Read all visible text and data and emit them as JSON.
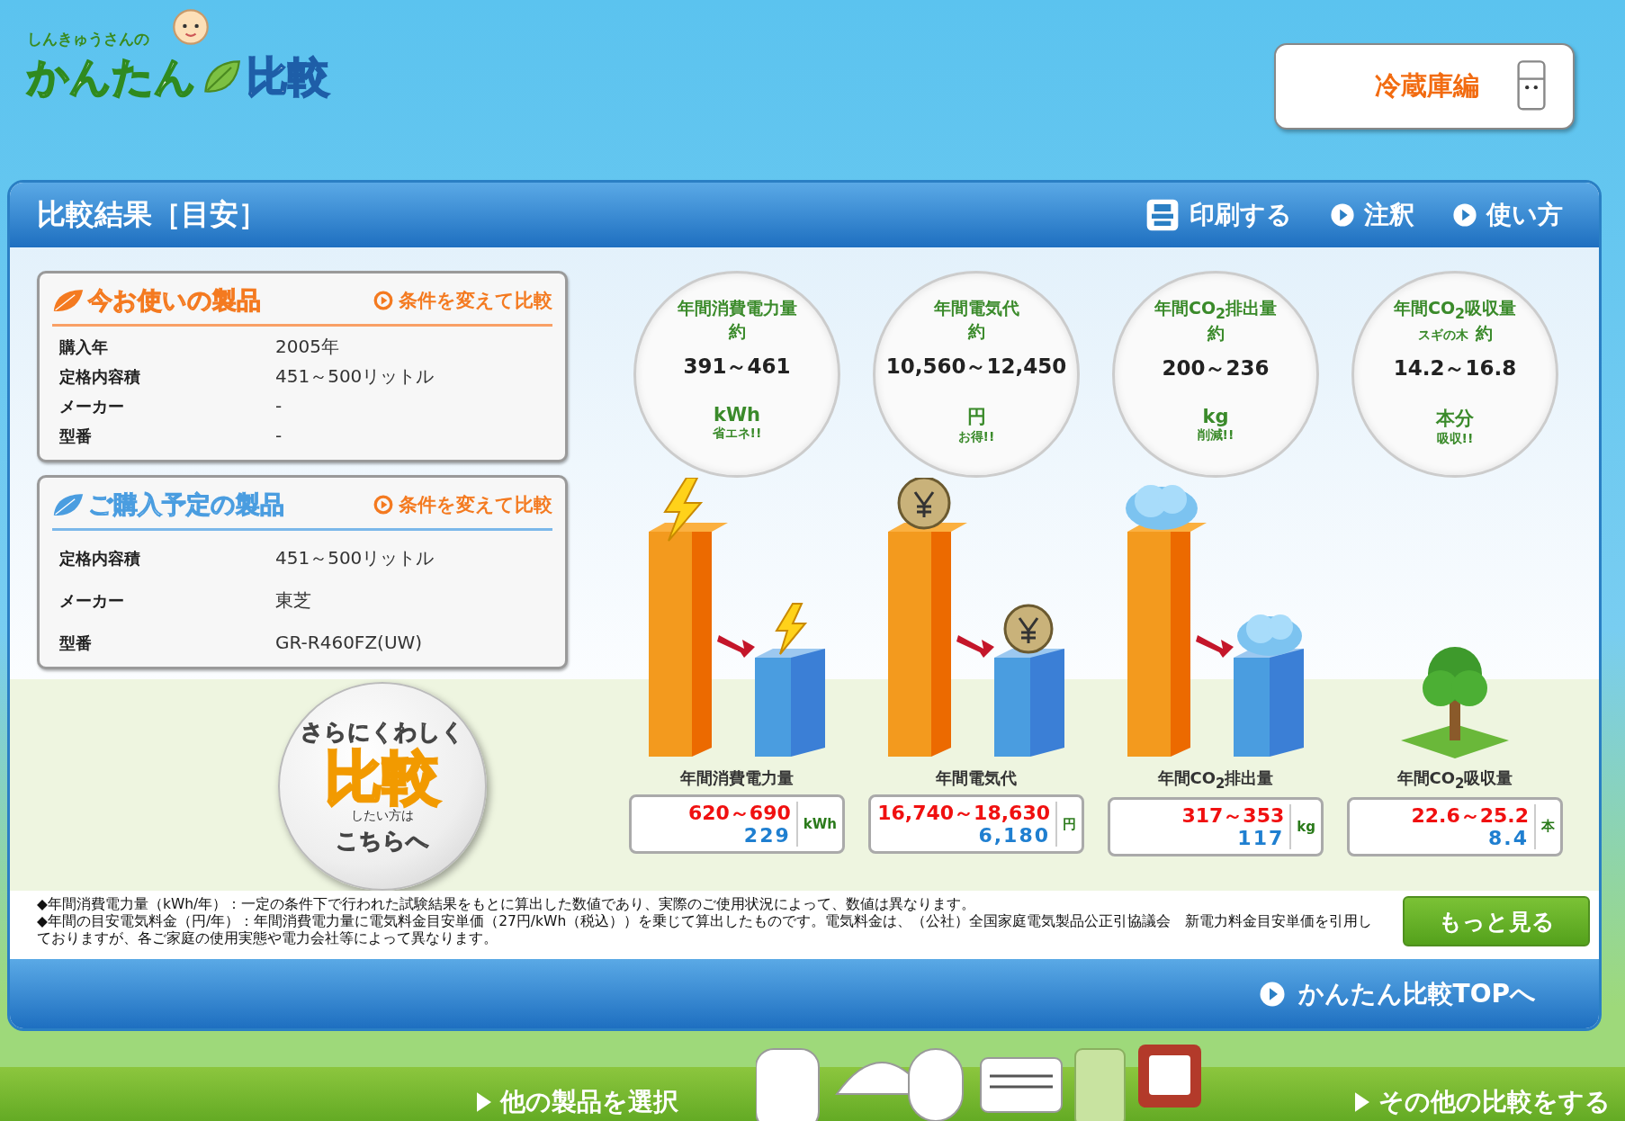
{
  "logo": {
    "tagline": "しんきゅうさんの",
    "title": "かんたん",
    "title_suffix": "比較"
  },
  "category_button": "冷蔵庫編",
  "panel": {
    "title": "比較結果［目安］",
    "actions": [
      {
        "kind": "print",
        "label": "印刷する"
      },
      {
        "kind": "link",
        "label": "注釈"
      },
      {
        "kind": "link",
        "label": "使い方"
      }
    ]
  },
  "current_product": {
    "title": "今お使いの製品",
    "change_link": "条件を変えて比較",
    "rows": [
      {
        "label": "購入年",
        "value": "2005年"
      },
      {
        "label": "定格内容積",
        "value": "451～500リットル"
      },
      {
        "label": "メーカー",
        "value": "-"
      },
      {
        "label": "型番",
        "value": "-"
      }
    ]
  },
  "planned_product": {
    "title": "ご購入予定の製品",
    "change_link": "条件を変えて比較",
    "rows": [
      {
        "label": "定格内容積",
        "value": "451～500リットル"
      },
      {
        "label": "メーカー",
        "value": "東芝"
      },
      {
        "label": "型番",
        "value": "GR-R460FZ(UW)"
      }
    ]
  },
  "detail_badge": {
    "line1": "さらにくわしく",
    "main": "比較",
    "small": "したい方は",
    "line2": "こちらへ"
  },
  "metrics": [
    {
      "kind": "power",
      "title": "年間消費電力量",
      "prefix": "約",
      "savings": "391～461",
      "unit": "kWh",
      "note": "省エネ!!",
      "bar_label": "年間消費電力量",
      "current": "620～690",
      "planned": "229",
      "box_unit": "kWh"
    },
    {
      "kind": "cost",
      "title": "年間電気代",
      "prefix": "約",
      "savings": "10,560～12,450",
      "unit": "円",
      "note": "お得!!",
      "bar_label": "年間電気代",
      "current": "16,740～18,630",
      "planned": "6,180",
      "box_unit": "円"
    },
    {
      "kind": "co2",
      "title": "年間CO$_{2}$排出量",
      "prefix": "約",
      "savings": "200～236",
      "unit": "kg",
      "note": "削減!!",
      "bar_label": "年間CO$_{2}$排出量",
      "current": "317～353",
      "planned": "117",
      "box_unit": "kg"
    },
    {
      "kind": "tree",
      "title": "年間CO$_{2}$吸収量",
      "qualifier": "スギの木",
      "prefix": "約",
      "savings": "14.2～16.8",
      "unit": "本分",
      "note": "吸収!!",
      "bar_label": "年間CO$_{2}$吸収量",
      "current": "22.6～25.2",
      "planned": "8.4",
      "box_unit": "本"
    }
  ],
  "notes": [
    "◆年間消費電力量（kWh/年）：一定の条件下で行われた試験結果をもとに算出した数値であり、実際のご使用状況によって、数値は異なります。",
    "◆年間の目安電気料金（円/年）：年間消費電力量に電気料金目安単価（27円/kWh（税込））を乗じて算出したものです。電気料金は、（公社）全国家庭電気製品公正引協議会　新電力料金目安単価を引用しておりますが、各ご家庭の使用実態や電力会社等によって異なります。"
  ],
  "more_button": "もっと見る",
  "top_link": "かんたん比較TOPへ",
  "bottom_links": [
    "他の製品を選択",
    "その他の比較をする"
  ]
}
